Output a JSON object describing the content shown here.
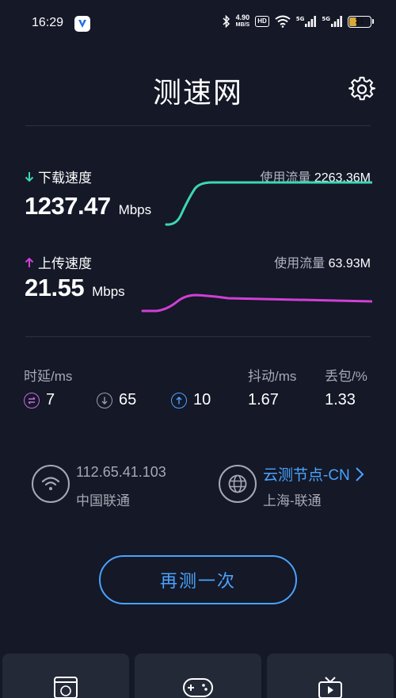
{
  "status_bar": {
    "time": "16:29",
    "net_speed_value": "4.90",
    "net_speed_unit": "MB/S",
    "hd_badge": "HD",
    "signal1_label": "5G",
    "signal2_label": "5G",
    "battery_level": "31"
  },
  "header": {
    "title": "测速网"
  },
  "download": {
    "label": "下载速度",
    "value": "1237.47",
    "unit": "Mbps",
    "usage_label": "使用流量",
    "usage_value": "2263.36M",
    "color": "#3dd6b4"
  },
  "upload": {
    "label": "上传速度",
    "value": "21.55",
    "unit": "Mbps",
    "usage_label": "使用流量",
    "usage_value": "63.93M",
    "color": "#d23fd6"
  },
  "stats": {
    "latency_label": "时延/ms",
    "jitter_label": "抖动/ms",
    "loss_label": "丢包/%",
    "ping_idle": "7",
    "ping_down": "65",
    "ping_up": "10",
    "jitter": "1.67",
    "loss": "1.33",
    "ping_idle_color": "#c86be0",
    "ping_down_color": "#9aa0ad",
    "ping_up_color": "#4aa3ff"
  },
  "connection": {
    "ip": "112.65.41.103",
    "isp": "中国联通",
    "node_name": "云测节点-CN",
    "node_location": "上海-联通"
  },
  "actions": {
    "retest_label": "再测一次"
  },
  "bottom_cards": [
    {
      "icon": "web-browser-icon"
    },
    {
      "icon": "gamepad-icon"
    },
    {
      "icon": "tv-icon"
    }
  ]
}
